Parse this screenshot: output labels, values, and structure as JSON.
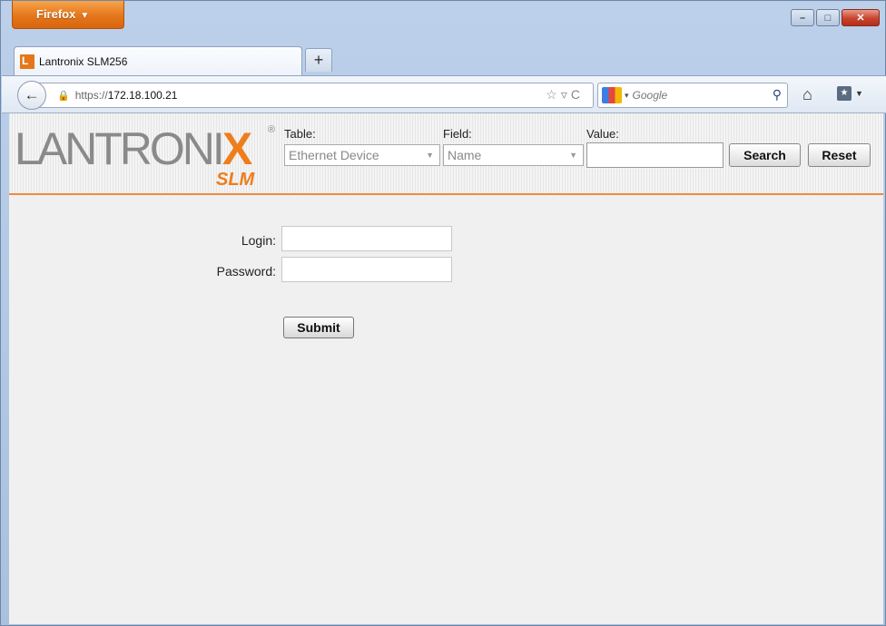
{
  "browser": {
    "app_button_label": "Firefox",
    "tab_title": "Lantronix SLM256",
    "new_tab_symbol": "+",
    "url_scheme": "https://",
    "url_host": "172.18.100.21",
    "search_placeholder": "Google",
    "window_controls": {
      "minimize": "–",
      "maximize": "□",
      "close": "✕"
    }
  },
  "header": {
    "logo_text": "LANTRONI",
    "logo_x": "X",
    "logo_reg": "®",
    "logo_sub": "SLM",
    "table_label": "Table:",
    "table_value": "Ethernet Device",
    "field_label": "Field:",
    "field_value": "Name",
    "value_label": "Value:",
    "value_input": "",
    "search_button": "Search",
    "reset_button": "Reset"
  },
  "login_form": {
    "login_label": "Login:",
    "login_value": "",
    "password_label": "Password:",
    "password_value": "",
    "submit_label": "Submit"
  },
  "colors": {
    "accent_orange": "#ef7d1c",
    "window_blue": "#bcd0ea",
    "content_bg": "#f0f0f0"
  }
}
